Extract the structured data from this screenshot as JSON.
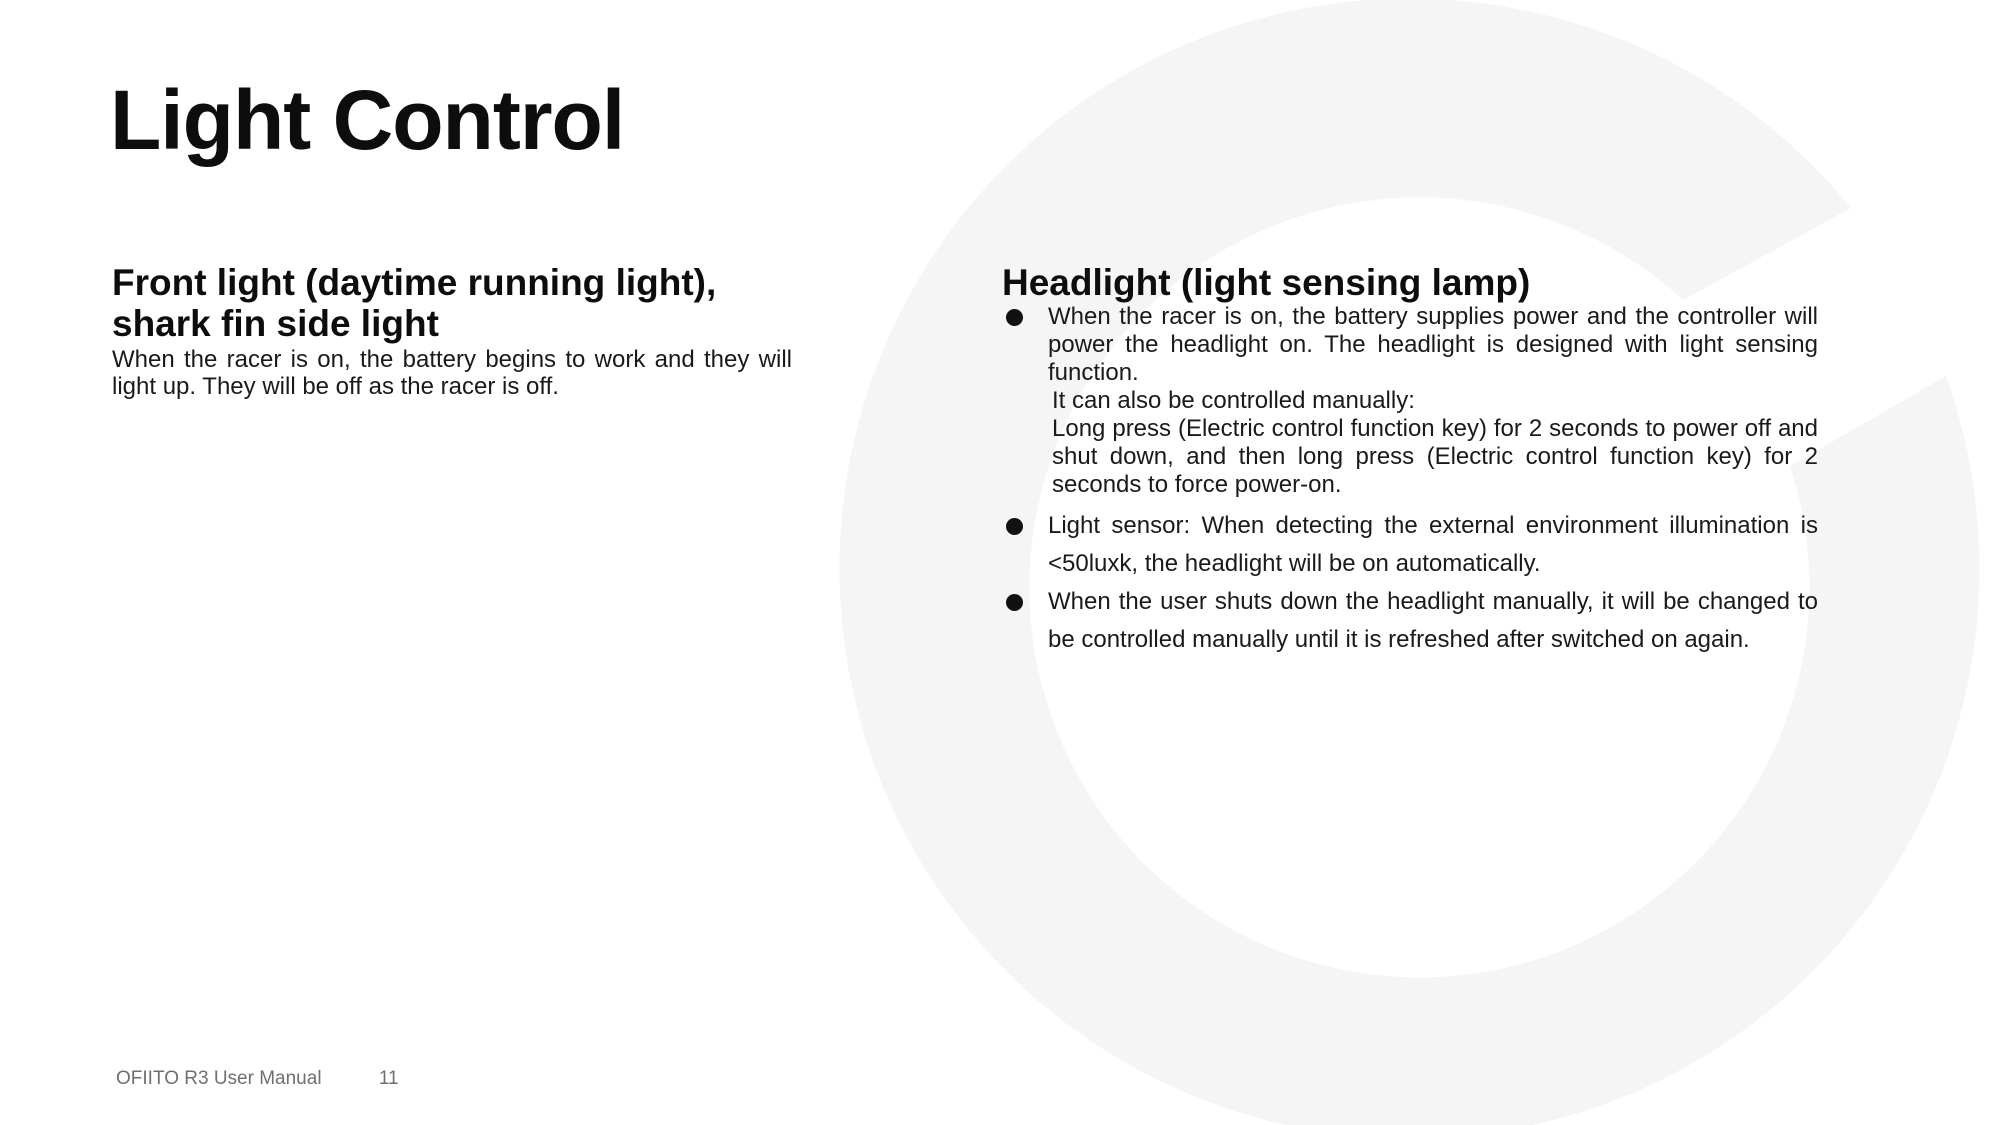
{
  "page": {
    "title": "Light Control"
  },
  "left_section": {
    "heading_line1": "Front light (daytime running light),",
    "heading_line2": "shark fin side light",
    "body": "When the racer is on, the battery begins to work and they will light up. They will be off as the racer is off."
  },
  "right_section": {
    "heading": "Headlight (light sensing lamp)",
    "bullets": [
      {
        "text": "When the racer is on, the battery supplies power and the controller will power the headlight on. The headlight is designed with light sensing function.",
        "extra_1": "It can also be controlled manually:",
        "extra_2": "Long press (Electric control function key) for 2 seconds to power off and shut down, and then long press (Electric control function key) for 2 seconds to force power-on."
      },
      {
        "text": "Light sensor: When detecting the external environment illumination is <50luxk, the headlight will be on automatically."
      },
      {
        "text": "When the user shuts down the headlight manually, it will be changed to be controlled manually until it is refreshed after switched on again."
      }
    ]
  },
  "footer": {
    "doc_name": "OFIITO R3 User Manual",
    "page_number": "11"
  },
  "colors": {
    "background": "#ffffff",
    "text": "#111111",
    "watermark": "#f5f5f5",
    "footer_text": "#6f6f6f"
  },
  "icons": {
    "background_logo": "c-ring-logo",
    "bullet": "filled-circle"
  }
}
